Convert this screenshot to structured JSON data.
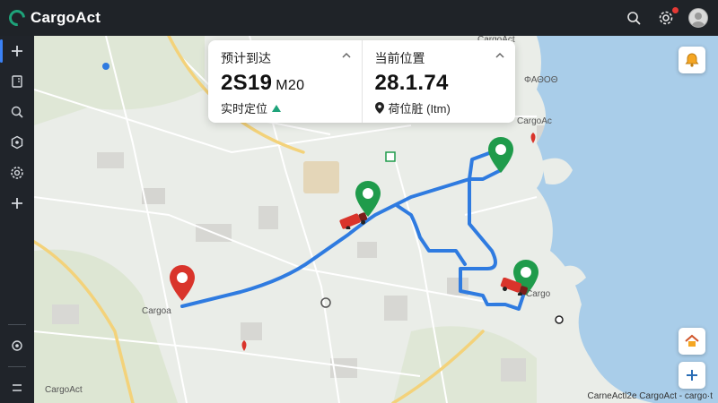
{
  "app": {
    "name": "CargoAct"
  },
  "header": {
    "icons": [
      "search-icon",
      "notification-settings-icon",
      "user-avatar-icon"
    ]
  },
  "sidebar": {
    "items": [
      {
        "icon": "plus-icon"
      },
      {
        "icon": "document-icon"
      },
      {
        "icon": "search-doc-icon"
      },
      {
        "icon": "location-cube-icon"
      },
      {
        "icon": "settings-icon"
      },
      {
        "icon": "plus-icon"
      }
    ],
    "bottom": [
      {
        "icon": "locate-icon"
      },
      {
        "icon": "menu-icon"
      }
    ]
  },
  "card": {
    "eta": {
      "title": "预计到达",
      "value": "2S19",
      "unit": "M20",
      "sub": "实时定位",
      "sub_icon": "trend-up-icon"
    },
    "position": {
      "title": "当前位置",
      "value": "28.1.74",
      "sub": "荷位脏 (Itm)",
      "sub_icon": "location-pin-icon"
    }
  },
  "map_labels": {
    "cargo_top": "CargoAct",
    "cargo_mid": "CargoAc",
    "cargo_left": "Cargoa",
    "cargo_right": "Cargo",
    "cargo_bottom": "CargoAct",
    "ae_label": "ΦΑΘΟΘ",
    "attribution": "CarneActl2e CargoAct - cargo·t"
  },
  "colors": {
    "header_bg": "#1f2328",
    "sidebar_bg": "#20242a",
    "route": "#2f7be0",
    "pin_red": "#d9342b",
    "pin_green": "#1f9b4b",
    "water": "#a9cde9",
    "accent_orange": "#f5a623"
  }
}
